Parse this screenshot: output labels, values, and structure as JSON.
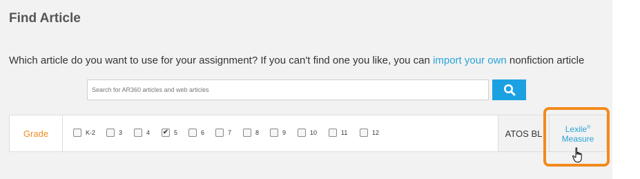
{
  "header": {
    "title": "Find Article"
  },
  "prompt": {
    "text_before": "Which article do you want to use for your assignment? If you can't find one you like, you can ",
    "link": "import your own",
    "text_after": " nonfiction article"
  },
  "search": {
    "placeholder": "Search for AR360 articles and web articles",
    "value": "",
    "button_icon": "search-icon"
  },
  "filters": {
    "grade_label": "Grade",
    "grades": [
      {
        "label": "K-2",
        "checked": false
      },
      {
        "label": "3",
        "checked": false
      },
      {
        "label": "4",
        "checked": false
      },
      {
        "label": "5",
        "checked": true
      },
      {
        "label": "6",
        "checked": false
      },
      {
        "label": "7",
        "checked": false
      },
      {
        "label": "8",
        "checked": false
      },
      {
        "label": "9",
        "checked": false
      },
      {
        "label": "10",
        "checked": false
      },
      {
        "label": "11",
        "checked": false
      },
      {
        "label": "12",
        "checked": false
      }
    ],
    "atos_label": "ATOS BL",
    "lexile_label_line1": "Lexile",
    "lexile_label_reg": "®",
    "lexile_label_line2": "Measure"
  },
  "colors": {
    "accent_blue": "#1ba1e2",
    "link_blue": "#29a3d6",
    "grade_orange": "#f08c1e",
    "highlight_orange": "#f28a1c"
  },
  "icons": {
    "cursor": "hand-pointer-icon"
  }
}
